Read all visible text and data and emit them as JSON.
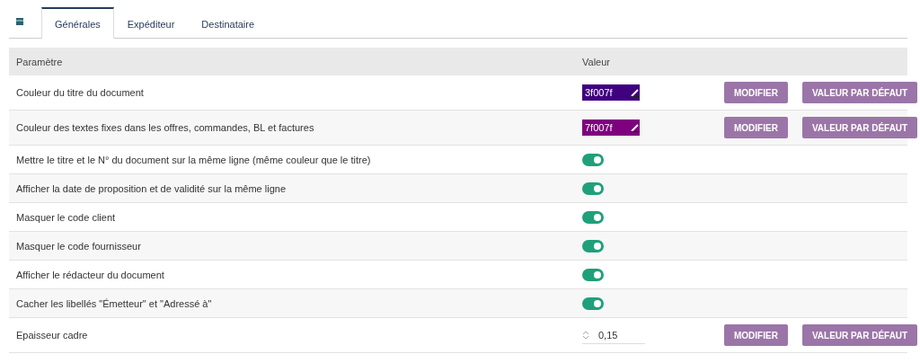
{
  "tabs": [
    {
      "label": "Générales",
      "selected": true
    },
    {
      "label": "Expéditeur",
      "selected": false
    },
    {
      "label": "Destinataire",
      "selected": false
    }
  ],
  "table": {
    "columns": [
      "Paramètre",
      "Valeur"
    ],
    "rows": [
      {
        "kind": "color",
        "label": "Couleur du titre du document",
        "value": "3f007f",
        "buttons": [
          "MODIFIER",
          "VALEUR PAR DÉFAUT"
        ]
      },
      {
        "kind": "color",
        "label": "Couleur des textes fixes dans les offres, commandes, BL et factures",
        "value": "7f007f",
        "buttons": [
          "MODIFIER",
          "VALEUR PAR DÉFAUT"
        ]
      },
      {
        "kind": "toggle",
        "label": "Mettre le titre et le N° du document sur la même ligne (même couleur que le titre)",
        "on": true
      },
      {
        "kind": "toggle",
        "label": "Afficher la date de proposition et de validité sur la même ligne",
        "on": true
      },
      {
        "kind": "toggle",
        "label": "Masquer le code client",
        "on": true
      },
      {
        "kind": "toggle",
        "label": "Masquer le code fournisseur",
        "on": true
      },
      {
        "kind": "toggle",
        "label": "Afficher le rédacteur du document",
        "on": true
      },
      {
        "kind": "toggle",
        "label": "Cacher les libellés \"Émetteur\" et \"Adressé à\"",
        "on": true
      },
      {
        "kind": "number",
        "label": "Epaisseur cadre",
        "value": "0,15",
        "buttons": [
          "MODIFIER",
          "VALEUR PAR DÉFAUT"
        ]
      }
    ]
  }
}
